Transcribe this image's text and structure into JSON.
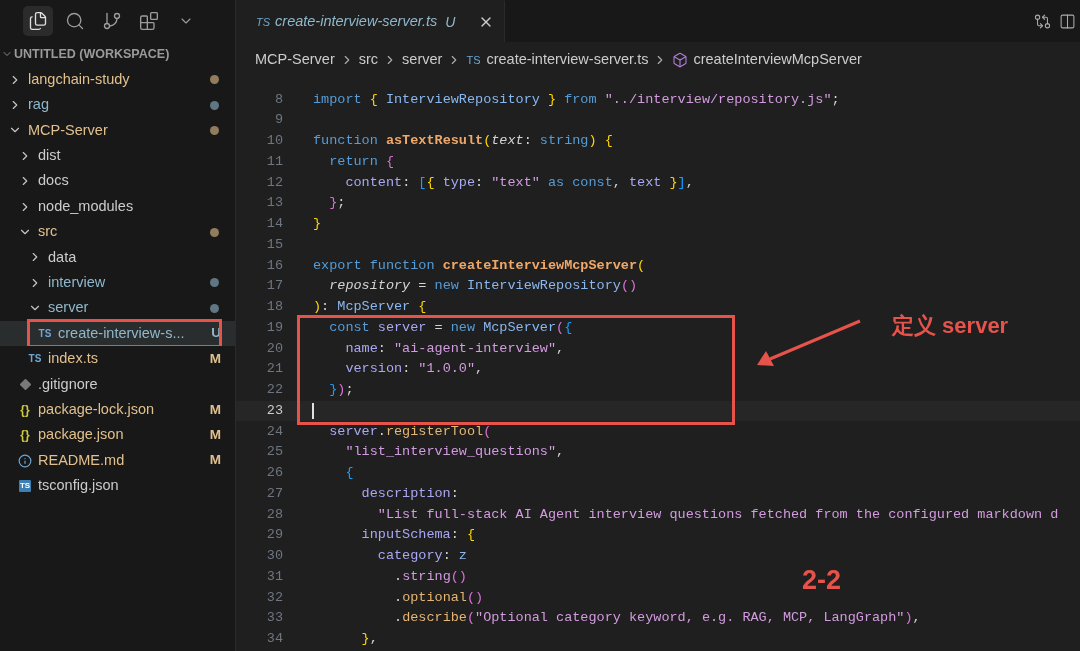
{
  "activity_bar": {
    "items": [
      {
        "kind": "files",
        "selected": true
      },
      {
        "kind": "search",
        "selected": false
      },
      {
        "kind": "source-control",
        "selected": false
      },
      {
        "kind": "extensions",
        "selected": false
      },
      {
        "kind": "more",
        "selected": false
      }
    ]
  },
  "explorer": {
    "workspace": "UNTITLED (WORKSPACE)",
    "expanded": true,
    "tree": [
      {
        "name": "langchain-study",
        "kind": "folder",
        "expanded": false,
        "color": "#e2c08d",
        "dot": true,
        "selected": false
      },
      {
        "name": "rag",
        "kind": "folder",
        "expanded": false,
        "color": "#8fb8cc",
        "dot": true,
        "selected": false
      },
      {
        "name": "MCP-Server",
        "kind": "folder",
        "expanded": true,
        "color": "#e2c08d",
        "dot": true,
        "selected": false,
        "children": [
          {
            "name": "dist",
            "kind": "folder",
            "expanded": false,
            "color": "#cccccc",
            "dot": false,
            "selected": false
          },
          {
            "name": "docs",
            "kind": "folder",
            "expanded": false,
            "color": "#cccccc",
            "dot": false,
            "selected": false
          },
          {
            "name": "node_modules",
            "kind": "folder",
            "expanded": false,
            "color": "#cccccc",
            "dot": false,
            "selected": false
          },
          {
            "name": "src",
            "kind": "folder",
            "expanded": true,
            "color": "#e2c08d",
            "dot": true,
            "selected": false,
            "children": [
              {
                "name": "data",
                "kind": "folder",
                "expanded": false,
                "color": "#cccccc",
                "dot": false,
                "selected": false
              },
              {
                "name": "interview",
                "kind": "folder",
                "expanded": false,
                "color": "#8fb8cc",
                "dot": true,
                "selected": false
              },
              {
                "name": "server",
                "kind": "folder",
                "expanded": true,
                "color": "#8fb8cc",
                "dot": true,
                "selected": false,
                "children": [
                  {
                    "name": "create-interview-s...",
                    "kind": "file",
                    "icon": {
                      "kind": "ts",
                      "text": "TS"
                    },
                    "color": "#8fb8cc",
                    "badge": "U",
                    "selected": true,
                    "boxed": true
                  }
                ]
              },
              {
                "name": "index.ts",
                "kind": "file",
                "icon": {
                  "kind": "ts",
                  "text": "TS"
                },
                "color": "#e2c08d",
                "badge": "M",
                "selected": false,
                "boxed": false
              }
            ]
          },
          {
            "name": ".gitignore",
            "kind": "file",
            "icon": {
              "kind": "git"
            },
            "color": "#cccccc",
            "selected": false,
            "boxed": false
          },
          {
            "name": "package-lock.json",
            "kind": "file",
            "icon": {
              "kind": "json",
              "text": "{}"
            },
            "color": "#e2c08d",
            "badge": "M",
            "selected": false,
            "boxed": false
          },
          {
            "name": "package.json",
            "kind": "file",
            "icon": {
              "kind": "json",
              "text": "{}"
            },
            "color": "#e2c08d",
            "badge": "M",
            "selected": false,
            "boxed": false
          },
          {
            "name": "README.md",
            "kind": "file",
            "icon": {
              "kind": "info"
            },
            "color": "#e2c08d",
            "badge": "M",
            "selected": false,
            "boxed": false
          },
          {
            "name": "tsconfig.json",
            "kind": "file",
            "icon": {
              "kind": "tsconfig",
              "text": "TS"
            },
            "color": "#cccccc",
            "selected": false,
            "boxed": false
          }
        ]
      }
    ]
  },
  "editor": {
    "tabs": [
      {
        "icon_text": "TS",
        "title": "create-interview-server.ts",
        "badge": "U",
        "selected": true
      }
    ],
    "breadcrumbs": [
      {
        "kind": "folder",
        "text": "MCP-Server"
      },
      {
        "kind": "folder",
        "text": "src"
      },
      {
        "kind": "folder",
        "text": "server"
      },
      {
        "kind": "file",
        "icon_text": "TS",
        "text": "create-interview-server.ts"
      },
      {
        "kind": "symbol",
        "text": "createInterviewMcpServer"
      }
    ],
    "lines": [
      {
        "number": "8",
        "current": false,
        "tokens": [
          {
            "kind": "kw",
            "t": "import "
          },
          {
            "kind": "b1",
            "t": "{ "
          },
          {
            "kind": "type",
            "t": "InterviewRepository "
          },
          {
            "kind": "b1",
            "t": "} "
          },
          {
            "kind": "kw",
            "t": "from "
          },
          {
            "kind": "str",
            "t": "\"../interview/repository.js\""
          },
          {
            "kind": "p",
            "t": ";"
          }
        ]
      },
      {
        "number": "9",
        "current": false
      },
      {
        "number": "10",
        "current": false,
        "tokens": [
          {
            "kind": "kw",
            "t": "function "
          },
          {
            "kind": "fn",
            "t": "asTextResult"
          },
          {
            "kind": "b1",
            "t": "("
          },
          {
            "kind": "param",
            "t": "text"
          },
          {
            "kind": "p",
            "t": ": "
          },
          {
            "kind": "kw",
            "t": "string"
          },
          {
            "kind": "b1",
            "t": ") {"
          }
        ]
      },
      {
        "number": "11",
        "current": false,
        "tokens": [
          {
            "kind": "kw",
            "t": "  return "
          },
          {
            "kind": "b2",
            "t": "{"
          }
        ]
      },
      {
        "number": "12",
        "current": false,
        "tokens": [
          {
            "kind": "prop",
            "t": "    content"
          },
          {
            "kind": "p",
            "t": ": "
          },
          {
            "kind": "b3",
            "t": "["
          },
          {
            "kind": "b1",
            "t": "{ "
          },
          {
            "kind": "prop",
            "t": "type"
          },
          {
            "kind": "p",
            "t": ": "
          },
          {
            "kind": "str",
            "t": "\"text\" "
          },
          {
            "kind": "kw",
            "t": "as const"
          },
          {
            "kind": "p",
            "t": ", "
          },
          {
            "kind": "prop",
            "t": "text "
          },
          {
            "kind": "b1",
            "t": "}"
          },
          {
            "kind": "b3",
            "t": "]"
          },
          {
            "kind": "p",
            "t": ","
          }
        ]
      },
      {
        "number": "13",
        "current": false,
        "tokens": [
          {
            "kind": "b2",
            "t": "  }"
          },
          {
            "kind": "p",
            "t": ";"
          }
        ]
      },
      {
        "number": "14",
        "current": false,
        "tokens": [
          {
            "kind": "b1",
            "t": "}"
          }
        ]
      },
      {
        "number": "15",
        "current": false
      },
      {
        "number": "16",
        "current": false,
        "tokens": [
          {
            "kind": "kw",
            "t": "export function "
          },
          {
            "kind": "fn",
            "t": "createInterviewMcpServer"
          },
          {
            "kind": "b1",
            "t": "("
          }
        ]
      },
      {
        "number": "17",
        "current": false,
        "tokens": [
          {
            "kind": "param",
            "t": "  repository"
          },
          {
            "kind": "p",
            "t": " = "
          },
          {
            "kind": "kw",
            "t": "new "
          },
          {
            "kind": "type",
            "t": "InterviewRepository"
          },
          {
            "kind": "b2",
            "t": "()"
          }
        ]
      },
      {
        "number": "18",
        "current": false,
        "tokens": [
          {
            "kind": "b1",
            "t": ")"
          },
          {
            "kind": "p",
            "t": ": "
          },
          {
            "kind": "type",
            "t": "McpServer "
          },
          {
            "kind": "b1",
            "t": "{"
          }
        ]
      },
      {
        "number": "19",
        "current": false,
        "tokens": [
          {
            "kind": "kw",
            "t": "  const "
          },
          {
            "kind": "prop",
            "t": "server"
          },
          {
            "kind": "p",
            "t": " = "
          },
          {
            "kind": "kw",
            "t": "new "
          },
          {
            "kind": "type",
            "t": "McpServer"
          },
          {
            "kind": "b2",
            "t": "("
          },
          {
            "kind": "b3",
            "t": "{"
          }
        ]
      },
      {
        "number": "20",
        "current": false,
        "tokens": [
          {
            "kind": "prop",
            "t": "    name"
          },
          {
            "kind": "p",
            "t": ": "
          },
          {
            "kind": "str",
            "t": "\"ai-agent-interview\""
          },
          {
            "kind": "p",
            "t": ","
          }
        ]
      },
      {
        "number": "21",
        "current": false,
        "tokens": [
          {
            "kind": "prop",
            "t": "    version"
          },
          {
            "kind": "p",
            "t": ": "
          },
          {
            "kind": "str",
            "t": "\"1.0.0\""
          },
          {
            "kind": "p",
            "t": ","
          }
        ]
      },
      {
        "number": "22",
        "current": false,
        "tokens": [
          {
            "kind": "b3",
            "t": "  }"
          },
          {
            "kind": "b2",
            "t": ")"
          },
          {
            "kind": "p",
            "t": ";"
          }
        ]
      },
      {
        "number": "23",
        "current": true
      },
      {
        "number": "24",
        "current": false,
        "tokens": [
          {
            "kind": "prop",
            "t": "  server"
          },
          {
            "kind": "p",
            "t": "."
          },
          {
            "kind": "method",
            "t": "registerTool"
          },
          {
            "kind": "b2",
            "t": "("
          }
        ]
      },
      {
        "number": "25",
        "current": false,
        "tokens": [
          {
            "kind": "str",
            "t": "    \"list_interview_questions\""
          },
          {
            "kind": "p",
            "t": ","
          }
        ]
      },
      {
        "number": "26",
        "current": false,
        "tokens": [
          {
            "kind": "b3",
            "t": "    {"
          }
        ]
      },
      {
        "number": "27",
        "current": false,
        "tokens": [
          {
            "kind": "prop",
            "t": "      description"
          },
          {
            "kind": "p",
            "t": ":"
          }
        ]
      },
      {
        "number": "28",
        "current": false,
        "tokens": [
          {
            "kind": "str",
            "t": "        \"List full-stack AI Agent interview questions fetched from the configured markdown d"
          }
        ]
      },
      {
        "number": "29",
        "current": false,
        "tokens": [
          {
            "kind": "prop",
            "t": "      inputSchema"
          },
          {
            "kind": "p",
            "t": ": "
          },
          {
            "kind": "b1",
            "t": "{"
          }
        ]
      },
      {
        "number": "30",
        "current": false,
        "tokens": [
          {
            "kind": "prop",
            "t": "        category"
          },
          {
            "kind": "p",
            "t": ": "
          },
          {
            "kind": "type",
            "t": "z"
          }
        ]
      },
      {
        "number": "31",
        "current": false,
        "tokens": [
          {
            "kind": "p",
            "t": "          ."
          },
          {
            "kind": "str",
            "t": "string"
          },
          {
            "kind": "b2",
            "t": "()"
          }
        ]
      },
      {
        "number": "32",
        "current": false,
        "tokens": [
          {
            "kind": "p",
            "t": "          ."
          },
          {
            "kind": "method",
            "t": "optional"
          },
          {
            "kind": "b2",
            "t": "()"
          }
        ]
      },
      {
        "number": "33",
        "current": false,
        "tokens": [
          {
            "kind": "p",
            "t": "          ."
          },
          {
            "kind": "method",
            "t": "describe"
          },
          {
            "kind": "b2",
            "t": "("
          },
          {
            "kind": "str",
            "t": "\"Optional category keyword, e.g. RAG, MCP, LangGraph\""
          },
          {
            "kind": "b2",
            "t": ")"
          },
          {
            "kind": "p",
            "t": ","
          }
        ]
      },
      {
        "number": "34",
        "current": false,
        "tokens": [
          {
            "kind": "b1",
            "t": "      }"
          },
          {
            "kind": "p",
            "t": ","
          }
        ]
      }
    ]
  },
  "annotations": [
    {
      "kind": "callout",
      "text": "定义 server"
    },
    {
      "kind": "page-label",
      "text": "2-2"
    }
  ]
}
